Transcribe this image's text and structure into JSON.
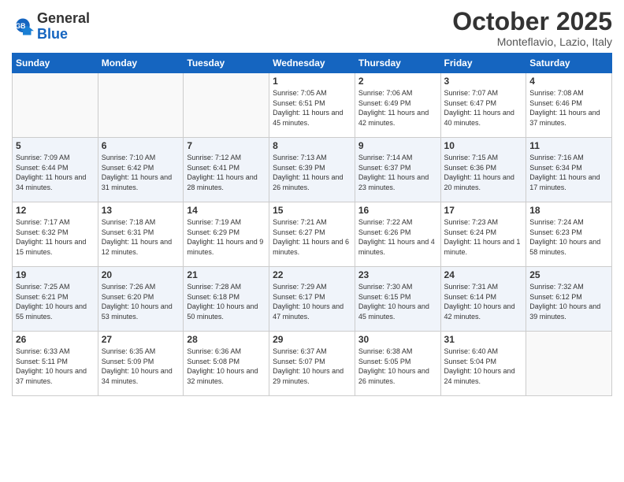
{
  "logo": {
    "general": "General",
    "blue": "Blue"
  },
  "title": "October 2025",
  "location": "Monteflavio, Lazio, Italy",
  "days_of_week": [
    "Sunday",
    "Monday",
    "Tuesday",
    "Wednesday",
    "Thursday",
    "Friday",
    "Saturday"
  ],
  "weeks": [
    [
      {
        "day": "",
        "info": ""
      },
      {
        "day": "",
        "info": ""
      },
      {
        "day": "",
        "info": ""
      },
      {
        "day": "1",
        "info": "Sunrise: 7:05 AM\nSunset: 6:51 PM\nDaylight: 11 hours and 45 minutes."
      },
      {
        "day": "2",
        "info": "Sunrise: 7:06 AM\nSunset: 6:49 PM\nDaylight: 11 hours and 42 minutes."
      },
      {
        "day": "3",
        "info": "Sunrise: 7:07 AM\nSunset: 6:47 PM\nDaylight: 11 hours and 40 minutes."
      },
      {
        "day": "4",
        "info": "Sunrise: 7:08 AM\nSunset: 6:46 PM\nDaylight: 11 hours and 37 minutes."
      }
    ],
    [
      {
        "day": "5",
        "info": "Sunrise: 7:09 AM\nSunset: 6:44 PM\nDaylight: 11 hours and 34 minutes."
      },
      {
        "day": "6",
        "info": "Sunrise: 7:10 AM\nSunset: 6:42 PM\nDaylight: 11 hours and 31 minutes."
      },
      {
        "day": "7",
        "info": "Sunrise: 7:12 AM\nSunset: 6:41 PM\nDaylight: 11 hours and 28 minutes."
      },
      {
        "day": "8",
        "info": "Sunrise: 7:13 AM\nSunset: 6:39 PM\nDaylight: 11 hours and 26 minutes."
      },
      {
        "day": "9",
        "info": "Sunrise: 7:14 AM\nSunset: 6:37 PM\nDaylight: 11 hours and 23 minutes."
      },
      {
        "day": "10",
        "info": "Sunrise: 7:15 AM\nSunset: 6:36 PM\nDaylight: 11 hours and 20 minutes."
      },
      {
        "day": "11",
        "info": "Sunrise: 7:16 AM\nSunset: 6:34 PM\nDaylight: 11 hours and 17 minutes."
      }
    ],
    [
      {
        "day": "12",
        "info": "Sunrise: 7:17 AM\nSunset: 6:32 PM\nDaylight: 11 hours and 15 minutes."
      },
      {
        "day": "13",
        "info": "Sunrise: 7:18 AM\nSunset: 6:31 PM\nDaylight: 11 hours and 12 minutes."
      },
      {
        "day": "14",
        "info": "Sunrise: 7:19 AM\nSunset: 6:29 PM\nDaylight: 11 hours and 9 minutes."
      },
      {
        "day": "15",
        "info": "Sunrise: 7:21 AM\nSunset: 6:27 PM\nDaylight: 11 hours and 6 minutes."
      },
      {
        "day": "16",
        "info": "Sunrise: 7:22 AM\nSunset: 6:26 PM\nDaylight: 11 hours and 4 minutes."
      },
      {
        "day": "17",
        "info": "Sunrise: 7:23 AM\nSunset: 6:24 PM\nDaylight: 11 hours and 1 minute."
      },
      {
        "day": "18",
        "info": "Sunrise: 7:24 AM\nSunset: 6:23 PM\nDaylight: 10 hours and 58 minutes."
      }
    ],
    [
      {
        "day": "19",
        "info": "Sunrise: 7:25 AM\nSunset: 6:21 PM\nDaylight: 10 hours and 55 minutes."
      },
      {
        "day": "20",
        "info": "Sunrise: 7:26 AM\nSunset: 6:20 PM\nDaylight: 10 hours and 53 minutes."
      },
      {
        "day": "21",
        "info": "Sunrise: 7:28 AM\nSunset: 6:18 PM\nDaylight: 10 hours and 50 minutes."
      },
      {
        "day": "22",
        "info": "Sunrise: 7:29 AM\nSunset: 6:17 PM\nDaylight: 10 hours and 47 minutes."
      },
      {
        "day": "23",
        "info": "Sunrise: 7:30 AM\nSunset: 6:15 PM\nDaylight: 10 hours and 45 minutes."
      },
      {
        "day": "24",
        "info": "Sunrise: 7:31 AM\nSunset: 6:14 PM\nDaylight: 10 hours and 42 minutes."
      },
      {
        "day": "25",
        "info": "Sunrise: 7:32 AM\nSunset: 6:12 PM\nDaylight: 10 hours and 39 minutes."
      }
    ],
    [
      {
        "day": "26",
        "info": "Sunrise: 6:33 AM\nSunset: 5:11 PM\nDaylight: 10 hours and 37 minutes."
      },
      {
        "day": "27",
        "info": "Sunrise: 6:35 AM\nSunset: 5:09 PM\nDaylight: 10 hours and 34 minutes."
      },
      {
        "day": "28",
        "info": "Sunrise: 6:36 AM\nSunset: 5:08 PM\nDaylight: 10 hours and 32 minutes."
      },
      {
        "day": "29",
        "info": "Sunrise: 6:37 AM\nSunset: 5:07 PM\nDaylight: 10 hours and 29 minutes."
      },
      {
        "day": "30",
        "info": "Sunrise: 6:38 AM\nSunset: 5:05 PM\nDaylight: 10 hours and 26 minutes."
      },
      {
        "day": "31",
        "info": "Sunrise: 6:40 AM\nSunset: 5:04 PM\nDaylight: 10 hours and 24 minutes."
      },
      {
        "day": "",
        "info": ""
      }
    ]
  ]
}
